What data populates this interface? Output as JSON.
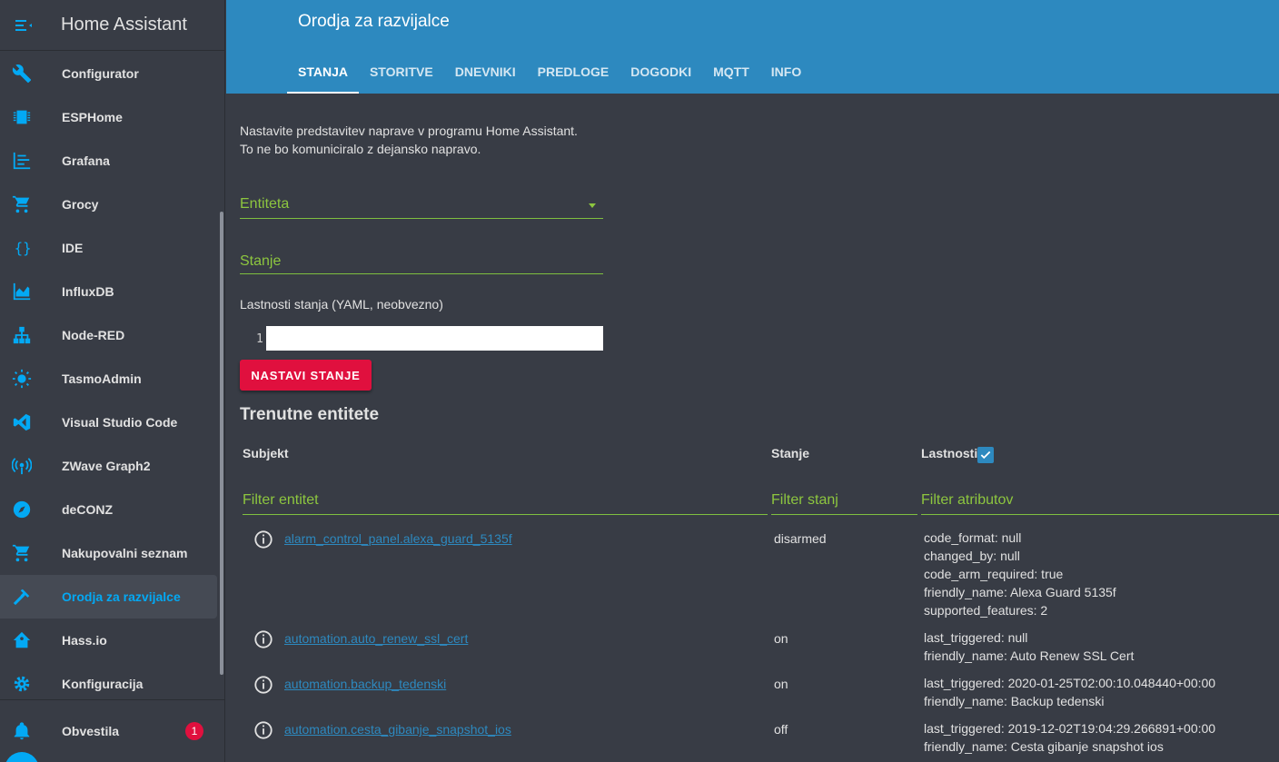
{
  "app": {
    "title": "Home Assistant"
  },
  "sidebar": {
    "items": [
      {
        "label": "Configurator",
        "icon": "wrench-icon"
      },
      {
        "label": "ESPHome",
        "icon": "chip-icon"
      },
      {
        "label": "Grafana",
        "icon": "chart-timeline-icon"
      },
      {
        "label": "Grocy",
        "icon": "cart-icon"
      },
      {
        "label": "IDE",
        "icon": "code-braces-icon"
      },
      {
        "label": "InfluxDB",
        "icon": "chart-areaspline-icon"
      },
      {
        "label": "Node-RED",
        "icon": "sitemap-icon"
      },
      {
        "label": "TasmoAdmin",
        "icon": "lightbulb-icon"
      },
      {
        "label": "Visual Studio Code",
        "icon": "vscode-icon"
      },
      {
        "label": "ZWave Graph2",
        "icon": "access-point-icon"
      },
      {
        "label": "deCONZ",
        "icon": "compass-icon"
      },
      {
        "label": "Nakupovalni seznam",
        "icon": "cart-icon"
      },
      {
        "label": "Orodja za razvijalce",
        "icon": "hammer-icon"
      },
      {
        "label": "Hass.io",
        "icon": "home-assistant-icon"
      },
      {
        "label": "Konfiguracija",
        "icon": "gear-icon"
      }
    ],
    "notifications": {
      "label": "Obvestila",
      "count": "1"
    }
  },
  "header": {
    "title": "Orodja za razvijalce",
    "tabs": [
      "STANJA",
      "STORITVE",
      "DNEVNIKI",
      "PREDLOGE",
      "DOGODKI",
      "MQTT",
      "INFO"
    ]
  },
  "main": {
    "description_line1": "Nastavite predstavitev naprave v programu Home Assistant.",
    "description_line2": "To ne bo komuniciralo z dejansko napravo.",
    "entity_label": "Entiteta",
    "state_label": "Stanje",
    "yaml_label": "Lastnosti stanja (YAML, neobvezno)",
    "line_number": "1",
    "set_state_button": "NASTAVI STANJE",
    "section_title": "Trenutne entitete",
    "columns": {
      "entity": "Subjekt",
      "state": "Stanje",
      "attributes": "Lastnosti"
    },
    "filters": {
      "entity": "Filter entitet",
      "state": "Filter stanj",
      "attributes": "Filter atributov"
    },
    "rows": [
      {
        "entity": "alarm_control_panel.alexa_guard_5135f",
        "state": "disarmed",
        "attributes": [
          "code_format: null",
          "changed_by: null",
          "code_arm_required: true",
          "friendly_name: Alexa Guard 5135f",
          "supported_features: 2"
        ]
      },
      {
        "entity": "automation.auto_renew_ssl_cert",
        "state": "on",
        "attributes": [
          "last_triggered: null",
          "friendly_name: Auto Renew SSL Cert"
        ]
      },
      {
        "entity": "automation.backup_tedenski",
        "state": "on",
        "attributes": [
          "last_triggered: 2020-01-25T02:00:10.048440+00:00",
          "friendly_name: Backup tedenski"
        ]
      },
      {
        "entity": "automation.cesta_gibanje_snapshot_ios",
        "state": "off",
        "attributes": [
          "last_triggered: 2019-12-02T19:04:29.266891+00:00",
          "friendly_name: Cesta gibanje snapshot ios"
        ]
      }
    ]
  },
  "colors": {
    "header": "#2d89bf",
    "accent": "#03a9f4",
    "field": "#8dc63f",
    "button": "#e0103e"
  }
}
